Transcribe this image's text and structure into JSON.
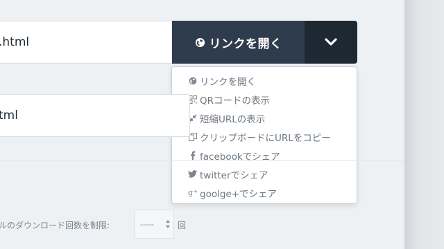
{
  "url_field_1": {
    "value": ".html"
  },
  "url_field_2": {
    "value": "tml"
  },
  "open_button": {
    "label": "リンクを開く",
    "icon": "globe-icon"
  },
  "dropdown_button": {
    "icon": "chevron-down-icon"
  },
  "menu": {
    "items": [
      {
        "label": "リンクを開く",
        "icon": "globe-icon"
      },
      {
        "label": "QRコードの表示",
        "icon": "qrcode-icon"
      },
      {
        "label": "短縮URLの表示",
        "icon": "compress-icon"
      },
      {
        "label": "クリップボードにURLをコピー",
        "icon": "copy-icon"
      },
      {
        "label": "facebookでシェア",
        "icon": "facebook-icon"
      },
      {
        "label": "twitterでシェア",
        "icon": "twitter-icon"
      },
      {
        "label": "goolge+でシェア",
        "icon": "google-plus-icon"
      }
    ]
  },
  "download_limit": {
    "label": "ルのダウンロード回数を制限:",
    "value": "-----",
    "unit": "回"
  },
  "colors": {
    "button_primary": "#2f3c4d",
    "button_dark": "#1e2833",
    "menu_text": "#6e7780"
  }
}
